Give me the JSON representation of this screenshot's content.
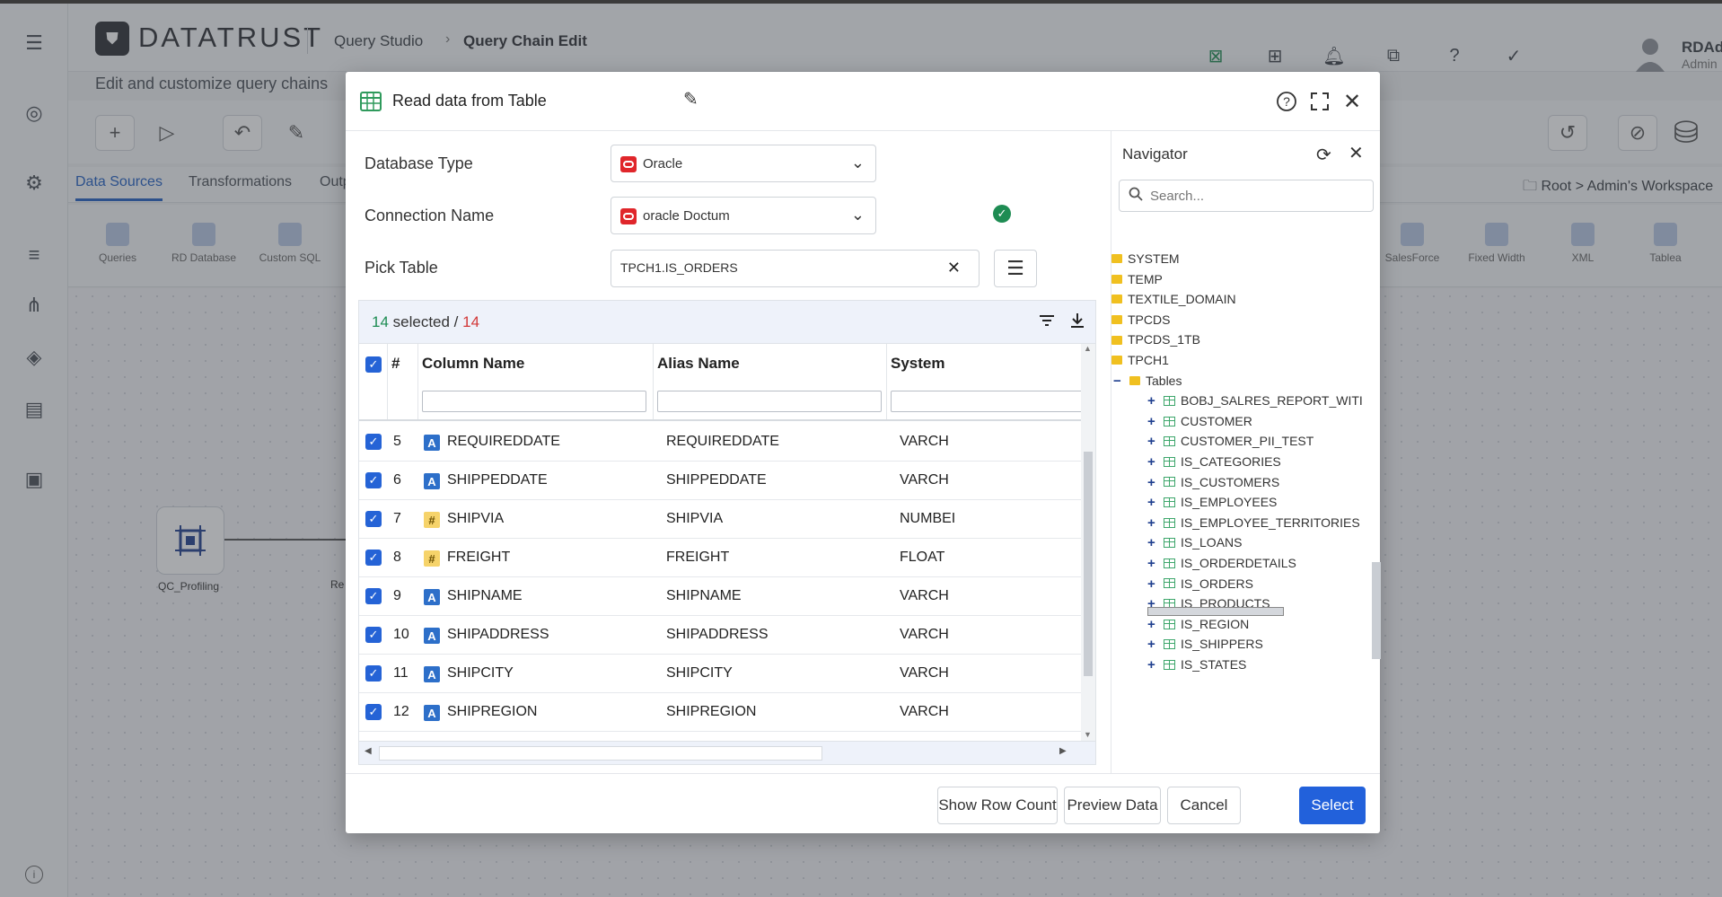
{
  "app": {
    "logo": "DATATRUST",
    "breadcrumb": [
      "Query Studio",
      "Query Chain Edit"
    ],
    "subtitle": "Edit and customize query chains",
    "user": {
      "name": "RDAdmin",
      "role": "Admin"
    },
    "tabs": [
      "Data Sources",
      "Transformations",
      "Outp"
    ],
    "root_path": "Root > Admin's Workspace",
    "palette": [
      "Queries",
      "RD Database",
      "Custom SQL",
      "SalesForce",
      "Fixed Width",
      "XML",
      "Tablea"
    ],
    "canvas": {
      "node_label": "QC_Profiling",
      "node_label2": "Re"
    }
  },
  "modal": {
    "title": "Read data from Table",
    "form": {
      "database_type_label": "Database Type",
      "database_type_value": "Oracle",
      "connection_label": "Connection Name",
      "connection_value": "oracle Doctum",
      "pick_table_label": "Pick Table",
      "pick_table_value": "TPCH1.IS_ORDERS"
    },
    "grid": {
      "selected": "14",
      "selected_suffix": " selected / ",
      "total": "14",
      "headers": {
        "num": "#",
        "column": "Column Name",
        "alias": "Alias Name",
        "system": "System"
      },
      "rows": [
        {
          "n": "5",
          "type": "A",
          "column": "REQUIREDDATE",
          "alias": "REQUIREDDATE",
          "system": "VARCH"
        },
        {
          "n": "6",
          "type": "A",
          "column": "SHIPPEDDATE",
          "alias": "SHIPPEDDATE",
          "system": "VARCH"
        },
        {
          "n": "7",
          "type": "#",
          "column": "SHIPVIA",
          "alias": "SHIPVIA",
          "system": "NUMBEI"
        },
        {
          "n": "8",
          "type": "#",
          "column": "FREIGHT",
          "alias": "FREIGHT",
          "system": "FLOAT"
        },
        {
          "n": "9",
          "type": "A",
          "column": "SHIPNAME",
          "alias": "SHIPNAME",
          "system": "VARCH"
        },
        {
          "n": "10",
          "type": "A",
          "column": "SHIPADDRESS",
          "alias": "SHIPADDRESS",
          "system": "VARCH"
        },
        {
          "n": "11",
          "type": "A",
          "column": "SHIPCITY",
          "alias": "SHIPCITY",
          "system": "VARCH"
        },
        {
          "n": "12",
          "type": "A",
          "column": "SHIPREGION",
          "alias": "SHIPREGION",
          "system": "VARCH"
        }
      ]
    },
    "navigator": {
      "title": "Navigator",
      "search_placeholder": "Search...",
      "schemas": [
        "SYSTEM",
        "TEMP",
        "TEXTILE_DOMAIN",
        "TPCDS",
        "TPCDS_1TB",
        "TPCH1"
      ],
      "tables_label": "Tables",
      "tables": [
        "BOBJ_SALRES_REPORT_WITI",
        "CUSTOMER",
        "CUSTOMER_PII_TEST",
        "IS_CATEGORIES",
        "IS_CUSTOMERS",
        "IS_EMPLOYEES",
        "IS_EMPLOYEE_TERRITORIES",
        "IS_LOANS",
        "IS_ORDERDETAILS",
        "IS_ORDERS",
        "IS_PRODUCTS",
        "IS_REGION",
        "IS_SHIPPERS",
        "IS_STATES"
      ]
    },
    "footer": {
      "show_row_count": "Show Row Count",
      "preview_data": "Preview Data",
      "cancel": "Cancel",
      "select": "Select"
    }
  },
  "colors": {
    "primary": "#2261db",
    "oracle": "#e0262b",
    "success": "#1e8c53",
    "danger": "#d23939"
  }
}
